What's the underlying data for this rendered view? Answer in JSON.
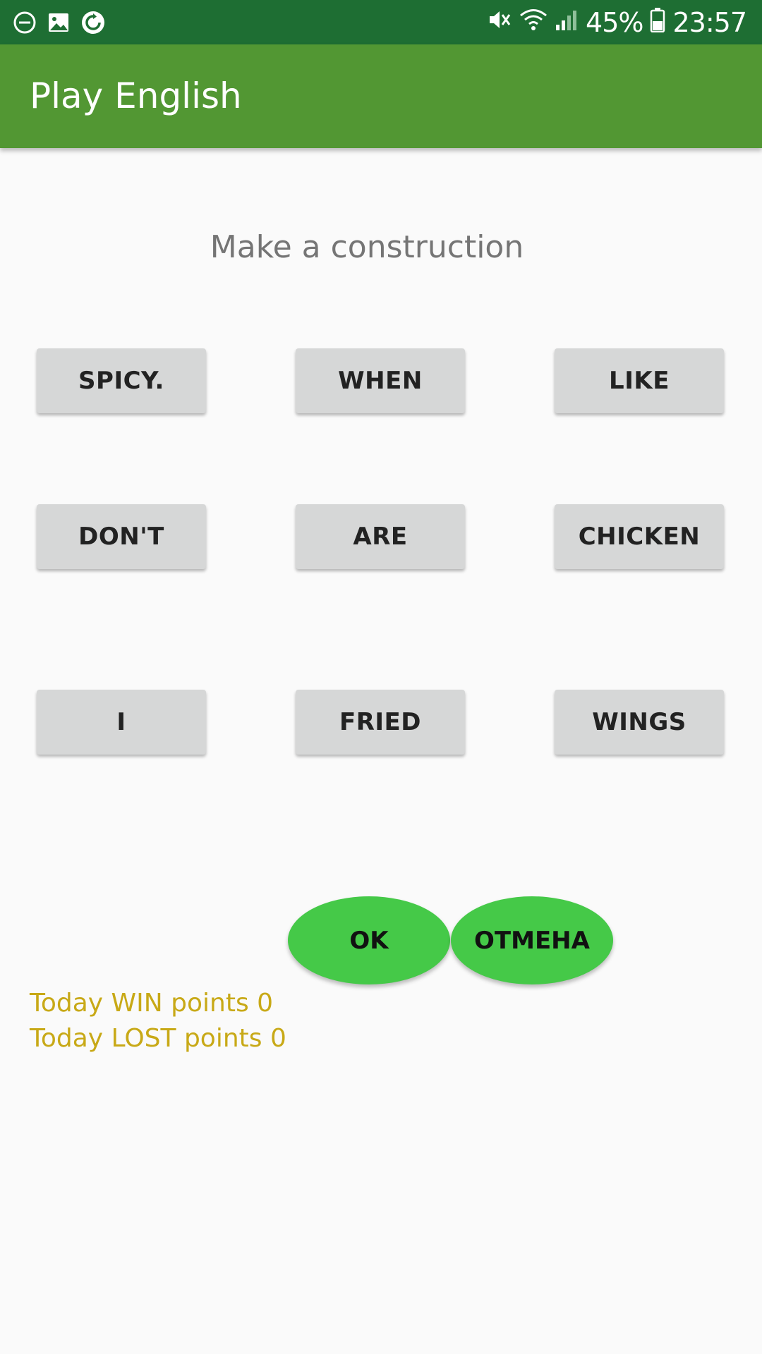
{
  "status_bar": {
    "battery_percent": "45%",
    "time": "23:57",
    "icons": [
      "do-not-disturb-icon",
      "image-icon",
      "sync-icon",
      "vibrate-icon",
      "wifi-icon",
      "signal-icon",
      "battery-icon"
    ]
  },
  "app_bar": {
    "title": "Play English"
  },
  "main": {
    "prompt": "Make a construction",
    "words": [
      "SPICY.",
      "WHEN",
      "LIKE",
      "DON'T",
      "ARE",
      "CHICKEN",
      "I",
      "FRIED",
      "WINGS"
    ],
    "ok_label": "OK",
    "cancel_label": "ОТМЕНА",
    "win_points": "Today WIN points 0",
    "lost_points": "Today LOST points 0"
  },
  "colors": {
    "status_bar": "#1e6e33",
    "app_bar": "#529733",
    "word_button": "#d6d7d7",
    "oval_button": "#45c948",
    "score_text": "#c8a917"
  }
}
